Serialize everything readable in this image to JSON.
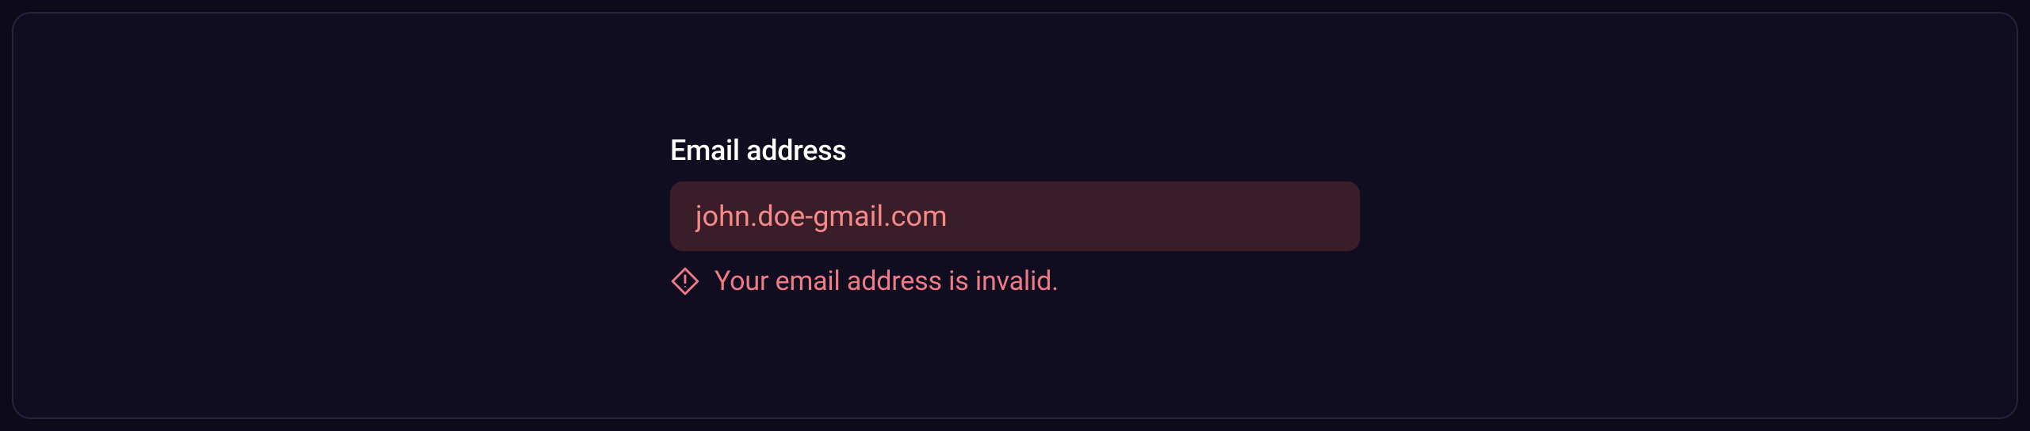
{
  "form": {
    "email": {
      "label": "Email address",
      "value": "john.doe-gmail.com",
      "error_message": "Your email address is invalid."
    }
  }
}
